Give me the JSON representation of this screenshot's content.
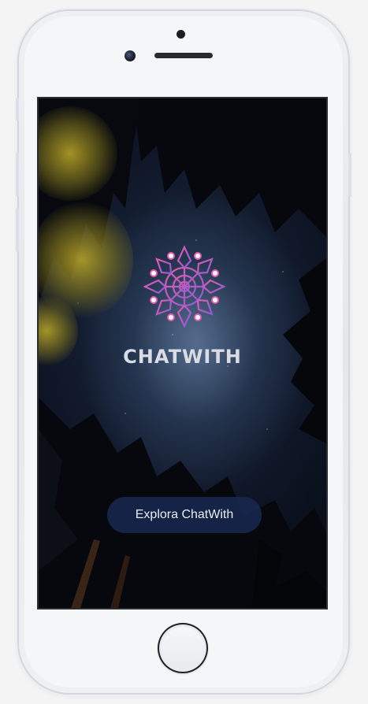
{
  "app": {
    "brand_name": "CHATWITH",
    "logo_icon": "mandala-icon"
  },
  "cta": {
    "label": "Explora ChatWith"
  },
  "colors": {
    "logo_pink": "#e65bb0",
    "logo_purple": "#8a5bd6",
    "cta_background": "#18284e",
    "brand_text": "#d9dce4"
  }
}
